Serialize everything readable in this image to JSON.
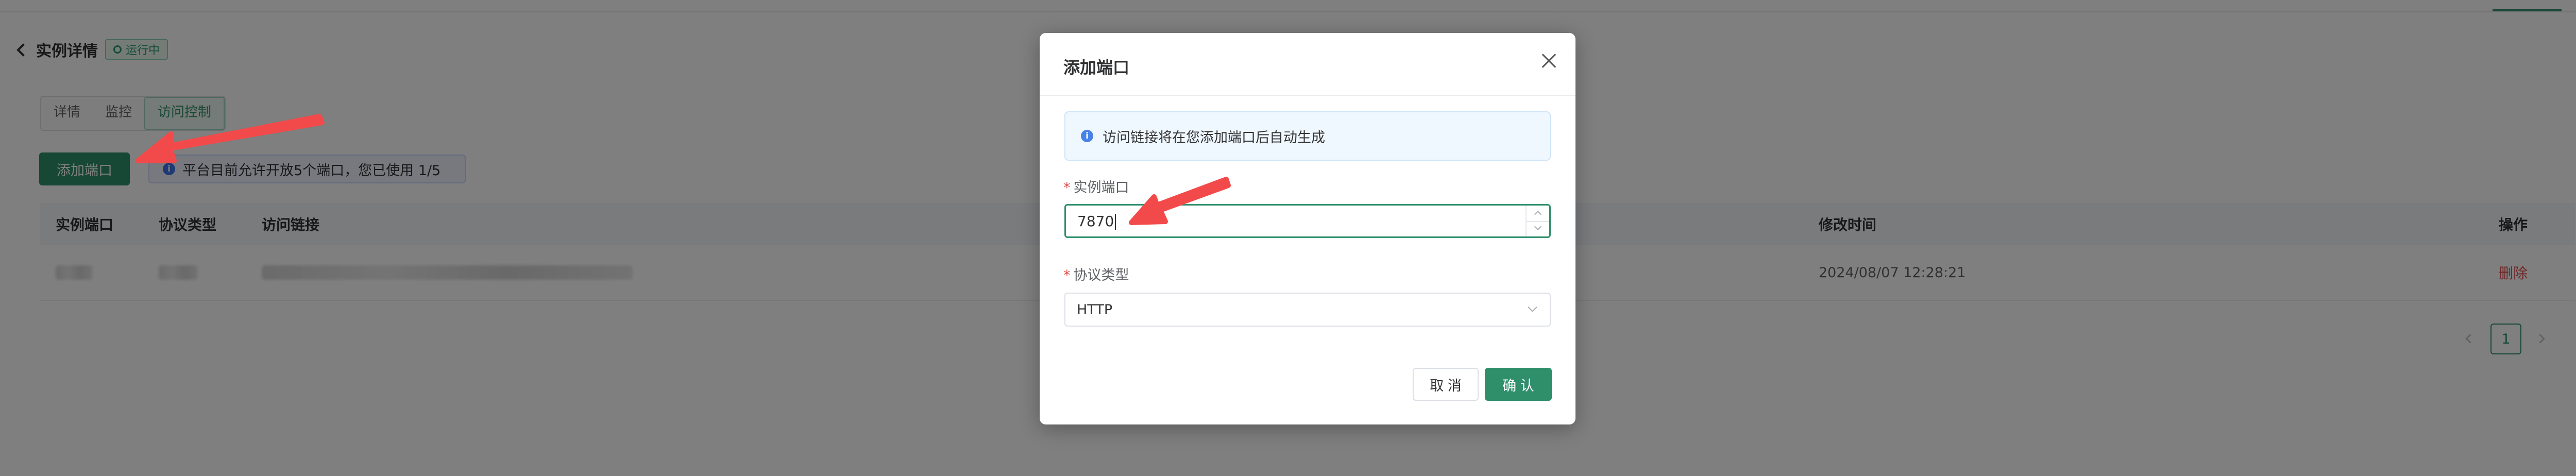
{
  "header": {
    "title": "实例详情",
    "status": "运行中"
  },
  "tabs": [
    {
      "label": "详情"
    },
    {
      "label": "监控"
    },
    {
      "label": "访问控制"
    }
  ],
  "toolbar": {
    "add_label": "添加端口",
    "notice": "平台目前允许开放5个端口，您已使用 1/5"
  },
  "table": {
    "columns": [
      "实例端口",
      "协议类型",
      "访问链接",
      "修改时间",
      "操作"
    ],
    "rows": [
      {
        "modified": "2024/08/07 12:28:21",
        "action": "删除"
      }
    ]
  },
  "pagination": {
    "current": "1"
  },
  "dialog": {
    "title": "添加端口",
    "alert": "访问链接将在您添加端口后自动生成",
    "port_label": "实例端口",
    "port_value": "7870",
    "protocol_label": "协议类型",
    "protocol_value": "HTTP",
    "required_mark": "*",
    "cancel_label": "取 消",
    "confirm_label": "确 认"
  },
  "colors": {
    "primary": "#2f8f6b",
    "danger": "#e24f4f",
    "annotation_arrow": "#f24a4a"
  }
}
